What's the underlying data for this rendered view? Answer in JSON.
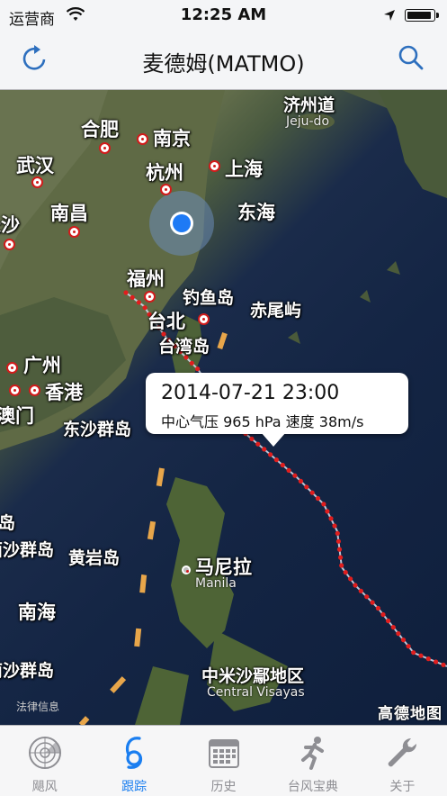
{
  "status_bar": {
    "carrier": "运营商",
    "time": "12:25 AM",
    "battery_level": 0.95
  },
  "nav": {
    "title": "麦德姆(MATMO)",
    "left_icon": "refresh-icon",
    "right_icon": "search-icon"
  },
  "map": {
    "labels": {
      "jeju": "济州道",
      "jeju_en": "Jeju-do",
      "hefei": "合肥",
      "nanjing": "南京",
      "wuhan": "武汉",
      "hangzhou": "杭州",
      "shanghai": "上海",
      "changsha": "长沙",
      "nanchang": "南昌",
      "donghai": "东海",
      "fuzhou": "福州",
      "diaoyudao": "钓鱼岛",
      "chiweiyu": "赤尾屿",
      "taibei": "台北",
      "taiwan": "台湾岛",
      "guangzhou": "广州",
      "xianggang": "香港",
      "aomen": "澳门",
      "dongsha": "东沙群岛",
      "xisha": "西沙群岛",
      "huangyan": "黄岩岛",
      "manila": "马尼拉",
      "manila_en": "Manila",
      "nanhai": "南海",
      "nansha": "南沙群岛",
      "visayas": "中米沙鄢地区",
      "visayas_en": "Central Visayas",
      "dao": "岛"
    },
    "legal": "法律信息",
    "provider": "高德地图"
  },
  "callout": {
    "time": "2014-07-21 23:00",
    "info": "中心气压 965 hPa 速度 38m/s"
  },
  "tabs": [
    {
      "label": "飓风",
      "icon": "radar-icon",
      "active": false
    },
    {
      "label": "跟踪",
      "icon": "typhoon-icon",
      "active": true
    },
    {
      "label": "历史",
      "icon": "calendar-icon",
      "active": false
    },
    {
      "label": "台风宝典",
      "icon": "runner-icon",
      "active": false
    },
    {
      "label": "关于",
      "icon": "wrench-icon",
      "active": false
    }
  ],
  "colors": {
    "accent": "#1a7ef0",
    "track": "#e01e1e",
    "inactive": "#8e8e93"
  }
}
